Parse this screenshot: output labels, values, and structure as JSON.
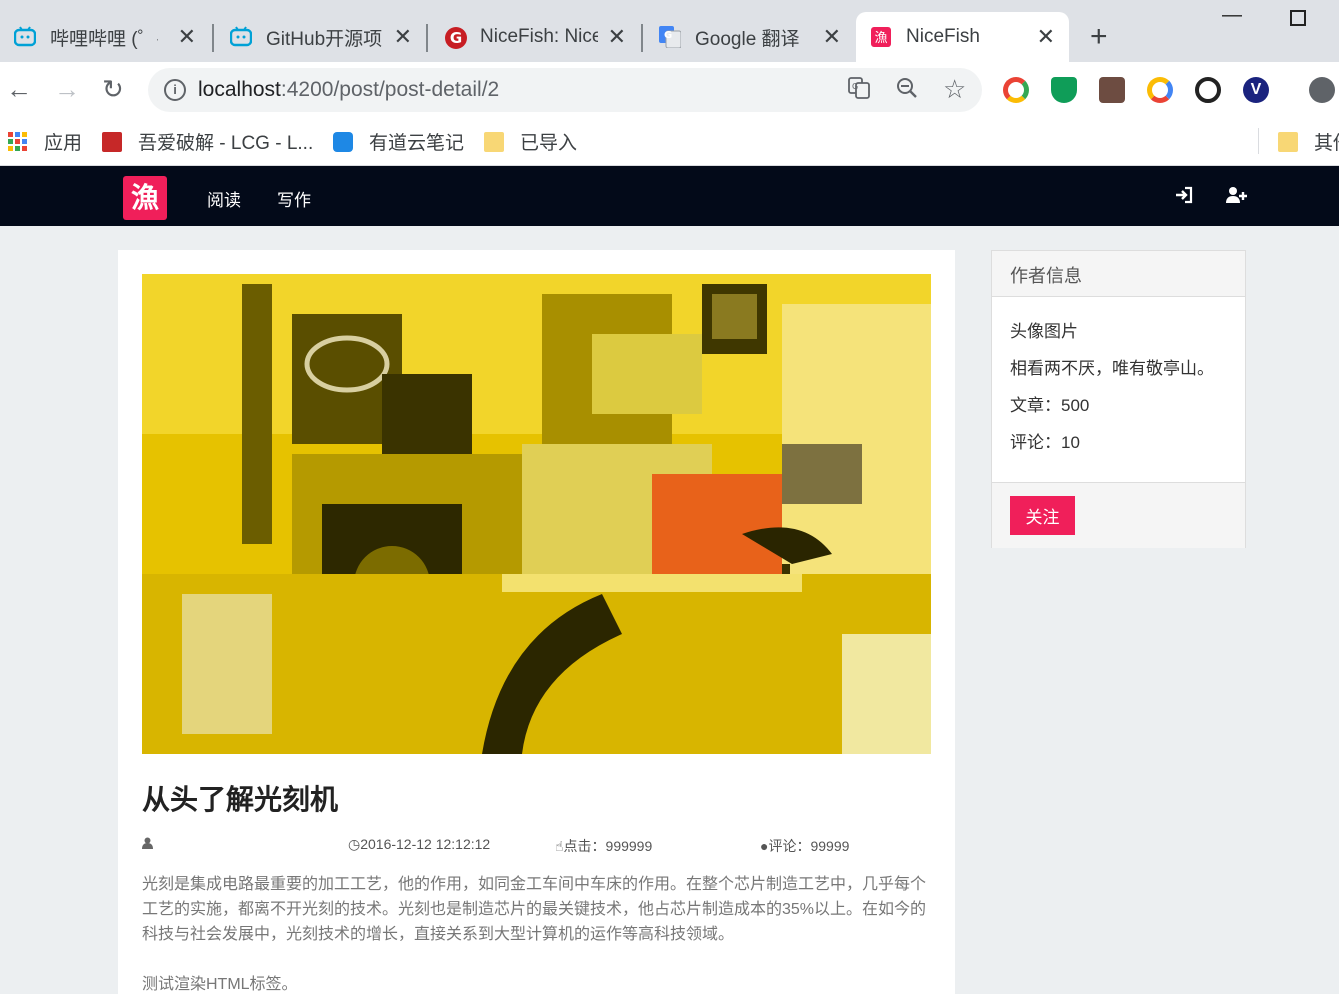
{
  "browser": {
    "tabs": [
      {
        "title": "哔哩哔哩 (゜-゜)つロ 干杯~",
        "icon": "bilibili-icon"
      },
      {
        "title": "GitHub开源项目",
        "icon": "bilibili-icon"
      },
      {
        "title": "NiceFish: NiceFish",
        "icon": "gitee-icon"
      },
      {
        "title": "Google 翻译",
        "icon": "google-translate-icon"
      },
      {
        "title": "NiceFish",
        "icon": "nicefish-icon"
      }
    ],
    "url_host": "localhost",
    "url_path": ":4200/post/post-detail/2",
    "bookmarks": [
      {
        "label": "应用",
        "icon": "apps-grid-icon"
      },
      {
        "label": "吾爱破解 - LCG - L...",
        "icon": "52pojie-icon"
      },
      {
        "label": "有道云笔记",
        "icon": "youdao-note-icon"
      },
      {
        "label": "已导入",
        "icon": "folder-icon"
      },
      {
        "label": "其他",
        "icon": "folder-icon"
      }
    ]
  },
  "site": {
    "logo": "漁",
    "nav": [
      "阅读",
      "写作"
    ],
    "accent": "#f01f5a",
    "nav_bg": "#030a19"
  },
  "post": {
    "title": "从头了解光刻机",
    "date": "2016-12-12 12:12:12",
    "clicks": "点击：999999",
    "comments": "评论：99999",
    "body": [
      "光刻是集成电路最重要的加工工艺，他的作用，如同金工车间中车床的作用。在整个芯片制造工艺中，几乎每个工艺的实施，都离不开光刻的技术。光刻也是制造芯片的最关键技术，他占芯片制造成本的35%以上。在如今的科技与社会发展中，光刻技术的增长，直接关系到大型计算机的运作等高科技领域。",
      "测试渲染HTML标签。"
    ]
  },
  "author": {
    "panel_title": "作者信息",
    "avatar": "头像图片",
    "motto": "相看两不厌，唯有敬亭山。",
    "articles": "文章：500",
    "comments": "评论：10",
    "follow_label": "关注"
  }
}
